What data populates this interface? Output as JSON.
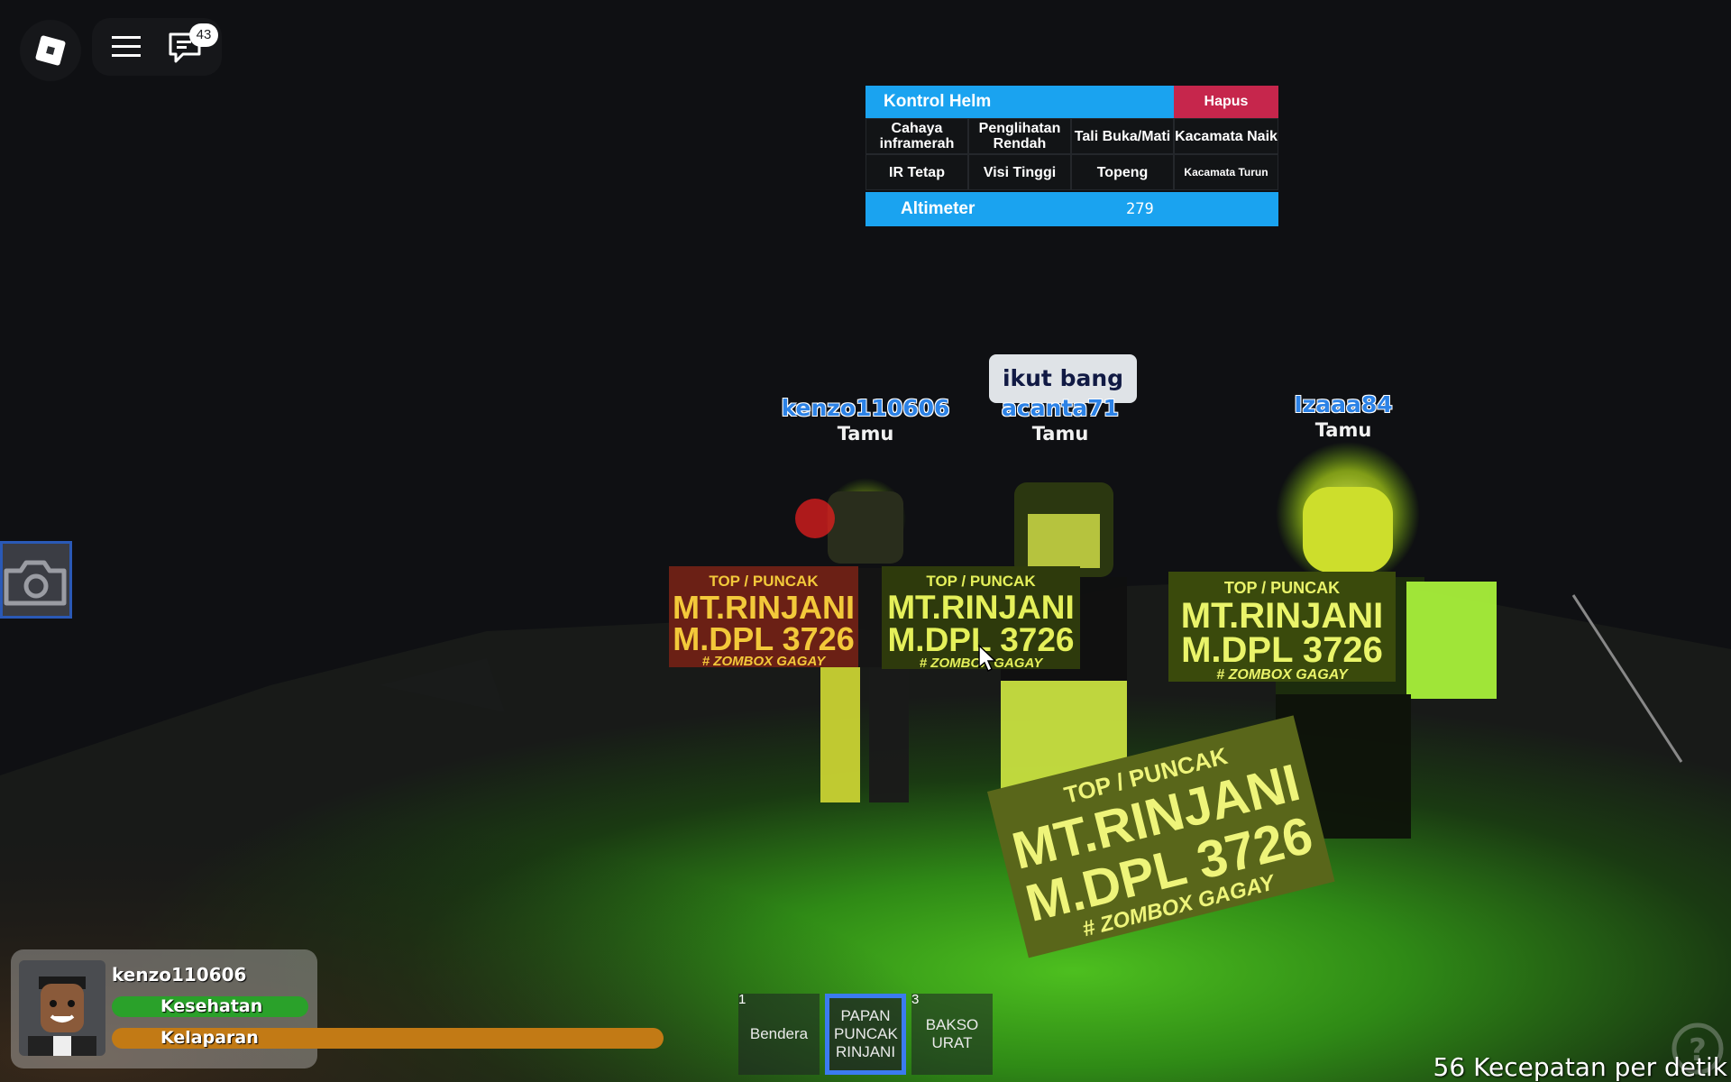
{
  "topbar": {
    "chat_badge": "43"
  },
  "helmet_panel": {
    "title": "Kontrol Helm",
    "delete_label": "Hapus",
    "buttons": [
      {
        "label": "Cahaya inframerah"
      },
      {
        "label": "Penglihatan Rendah"
      },
      {
        "label": "Tali Buka/Mati"
      },
      {
        "label": "Kacamata Naik"
      },
      {
        "label": "IR Tetap"
      },
      {
        "label": "Visi Tinggi"
      },
      {
        "label": "Topeng"
      },
      {
        "label": "Kacamata Turun"
      }
    ],
    "altimeter_label": "Altimeter",
    "altimeter_value": "279"
  },
  "chat_bubble": "ikut bang",
  "players": [
    {
      "name": "kenzo110606",
      "role": "Tamu"
    },
    {
      "name": "acanta71",
      "role": "Tamu"
    },
    {
      "name": "Izaaa84",
      "role": "Tamu"
    }
  ],
  "signboard": {
    "line1": "TOP / PUNCAK",
    "line2": "MT.RINJANI",
    "line3": "M.DPL 3726",
    "line4": "# ZOMBOX GAGAY"
  },
  "stats": {
    "player_name": "kenzo110606",
    "health_label": "Kesehatan",
    "hunger_label": "Kelaparan"
  },
  "hotbar": [
    {
      "num": "1",
      "label": "Bendera",
      "selected": false
    },
    {
      "num": "",
      "label": "PAPAN PUNCAK RINJANI",
      "selected": true
    },
    {
      "num": "3",
      "label": "BAKSO URAT",
      "selected": false
    }
  ],
  "speed_text": "56 Kecepatan per detik",
  "colors": {
    "panel_blue": "#1aa3f0",
    "delete_red": "#c6264c",
    "name_blue": "#2c82e6",
    "health_green": "#2aa12a",
    "hunger_orange": "#c27a15",
    "hotbar_select": "#3b7bf0"
  },
  "icons": [
    "roblox-logo-icon",
    "hamburger-menu-icon",
    "chat-icon",
    "camera-icon",
    "help-icon"
  ]
}
